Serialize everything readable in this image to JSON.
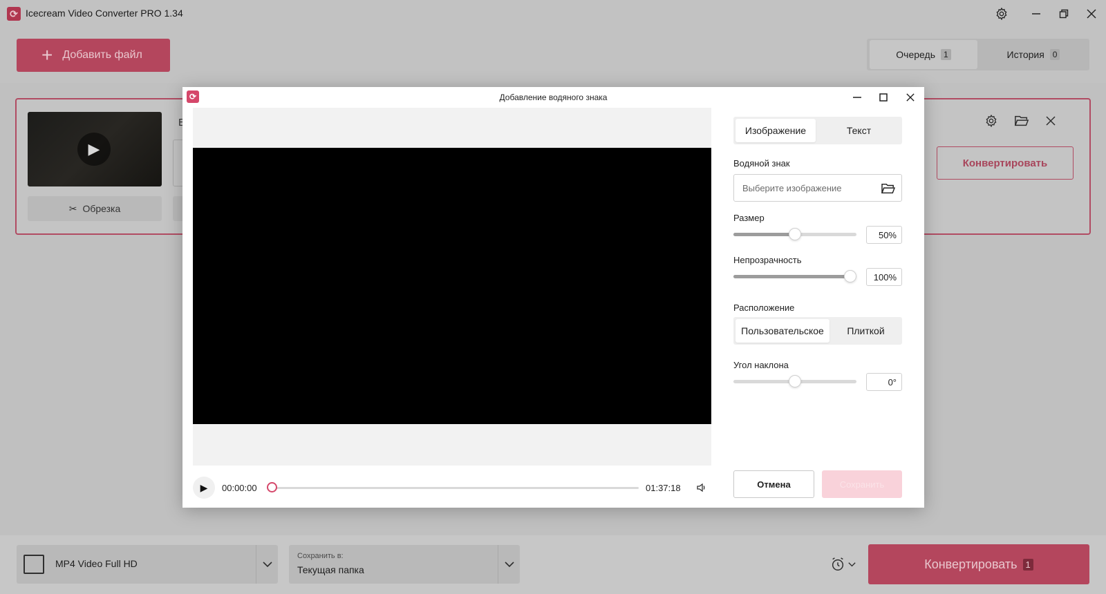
{
  "app": {
    "title": "Icecream Video Converter PRO 1.34",
    "add_file_label": "Добавить файл",
    "tabs": [
      {
        "label": "Очередь",
        "count": "1"
      },
      {
        "label": "История",
        "count": "0"
      }
    ]
  },
  "file_card": {
    "crop_label": "Обрезка",
    "partial_text": "В",
    "convert_label": "Конвертировать"
  },
  "bottom": {
    "format_label": "MP4 Video Full HD",
    "save_caption": "Сохранить в:",
    "save_value": "Текущая папка",
    "convert_label": "Конвертировать",
    "convert_count": "1"
  },
  "dialog": {
    "title": "Добавление водяного знака",
    "tabs": [
      {
        "label": "Изображение",
        "active": true
      },
      {
        "label": "Текст",
        "active": false
      }
    ],
    "watermark_label": "Водяной знак",
    "watermark_placeholder": "Выберите изображение",
    "size_label": "Размер",
    "size_value": "50%",
    "size_level": 0.5,
    "opacity_label": "Непрозрачность",
    "opacity_value": "100%",
    "opacity_level": 1.0,
    "position_label": "Расположение",
    "position_options": [
      {
        "label": "Пользовательское",
        "active": true
      },
      {
        "label": "Плиткой",
        "active": false
      }
    ],
    "angle_label": "Угол наклона",
    "angle_value": "0°",
    "angle_level": 0.5,
    "cancel_label": "Отмена",
    "save_label": "Сохранить",
    "player": {
      "current_time": "00:00:00",
      "total_time": "01:37:18",
      "progress": 0
    }
  },
  "colors": {
    "accent": "#d5476a",
    "dim_accent": "#b4465d"
  }
}
